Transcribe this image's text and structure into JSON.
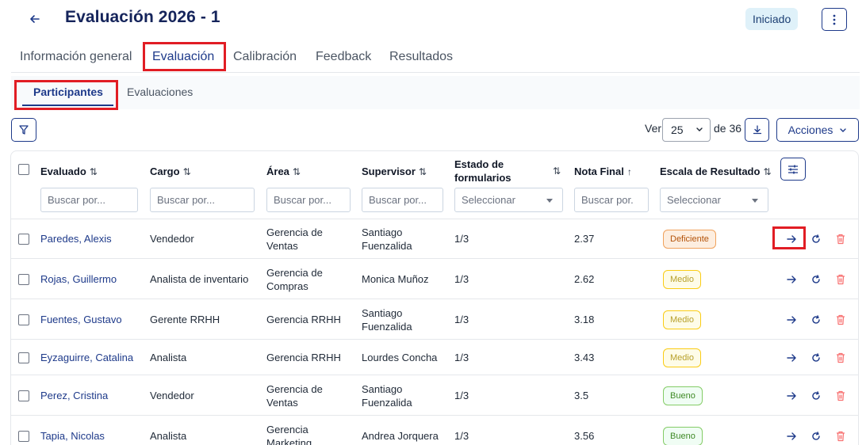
{
  "header": {
    "title": "Evaluación 2026 - 1",
    "status": "Iniciado"
  },
  "tabs": [
    {
      "label": "Información general",
      "active": false
    },
    {
      "label": "Evaluación",
      "active": true
    },
    {
      "label": "Calibración",
      "active": false
    },
    {
      "label": "Feedback",
      "active": false
    },
    {
      "label": "Resultados",
      "active": false
    }
  ],
  "subtabs": [
    {
      "label": "Participantes",
      "active": true
    },
    {
      "label": "Evaluaciones",
      "active": false
    }
  ],
  "toolbar": {
    "ver_label": "Ver",
    "page_size": "25",
    "total_label": "de 36",
    "actions_label": "Acciones"
  },
  "table": {
    "headers": {
      "evaluado": "Evaluado",
      "cargo": "Cargo",
      "area": "Área",
      "supervisor": "Supervisor",
      "estado_line1": "Estado de",
      "estado_line2": "formularios",
      "nota": "Nota Final",
      "escala": "Escala de Resultado"
    },
    "filters": {
      "search_placeholder": "Buscar por...",
      "nota_placeholder": "Buscar por.",
      "select_placeholder": "Seleccionar"
    },
    "rows": [
      {
        "name": "Paredes, Alexis",
        "cargo": "Vendedor",
        "area_1": "Gerencia de",
        "area_2": "Ventas",
        "sup_1": "Santiago",
        "sup_2": "Fuenzalida",
        "estado": "1/3",
        "nota": "2.37",
        "escala": "Deficiente",
        "escala_level": "deficiente"
      },
      {
        "name": "Rojas, Guillermo",
        "cargo": "Analista de inventario",
        "area_1": "Gerencia de",
        "area_2": "Compras",
        "sup_1": "Monica Muñoz",
        "sup_2": "",
        "estado": "1/3",
        "nota": "2.62",
        "escala": "Medio",
        "escala_level": "medio"
      },
      {
        "name": "Fuentes, Gustavo",
        "cargo": "Gerente RRHH",
        "area_1": "Gerencia RRHH",
        "area_2": "",
        "sup_1": "Santiago",
        "sup_2": "Fuenzalida",
        "estado": "1/3",
        "nota": "3.18",
        "escala": "Medio",
        "escala_level": "medio"
      },
      {
        "name": "Eyzaguirre, Catalina",
        "cargo": "Analista",
        "area_1": "Gerencia RRHH",
        "area_2": "",
        "sup_1": "Lourdes Concha",
        "sup_2": "",
        "estado": "1/3",
        "nota": "3.43",
        "escala": "Medio",
        "escala_level": "medio"
      },
      {
        "name": "Perez, Cristina",
        "cargo": "Vendedor",
        "area_1": "Gerencia de",
        "area_2": "Ventas",
        "sup_1": "Santiago",
        "sup_2": "Fuenzalida",
        "estado": "1/3",
        "nota": "3.5",
        "escala": "Bueno",
        "escala_level": "bueno"
      },
      {
        "name": "Tapia, Nicolas",
        "cargo": "Analista",
        "area_1": "Gerencia",
        "area_2": "Marketing",
        "sup_1": "Andrea Jorquera",
        "sup_2": "",
        "estado": "1/3",
        "nota": "3.56",
        "escala": "Bueno",
        "escala_level": "bueno"
      }
    ]
  },
  "icons": {
    "back": "arrow-left-icon",
    "more": "kebab-icon",
    "filter": "funnel-icon",
    "download": "download-icon",
    "columns": "sliders-icon",
    "open": "arrow-right-icon",
    "reset": "refresh-icon",
    "delete": "trash-icon"
  },
  "colors": {
    "primary": "#1e3a8a",
    "highlight": "#e11d24",
    "delete": "#f87171"
  }
}
